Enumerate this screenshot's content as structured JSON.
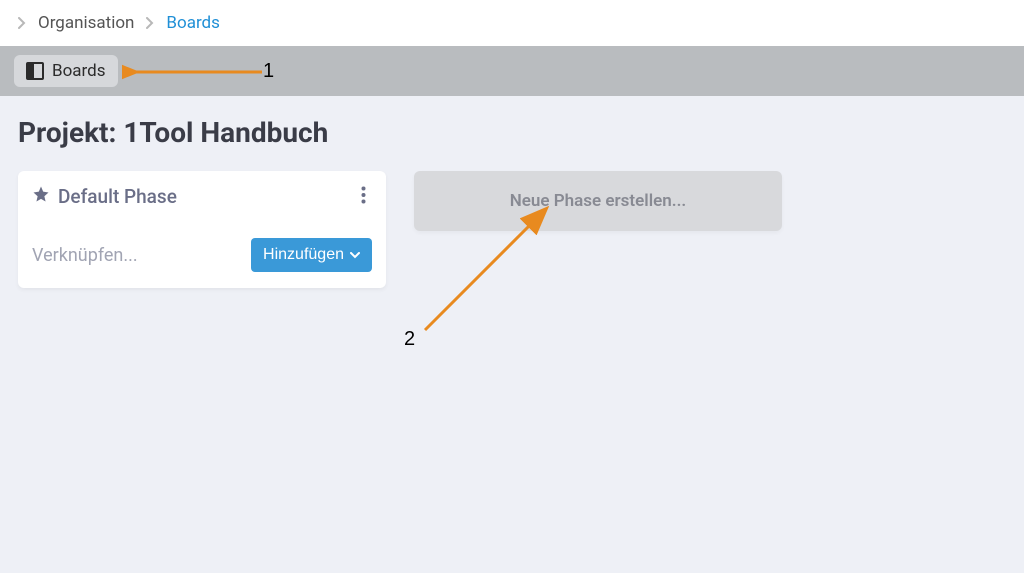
{
  "breadcrumb": {
    "item1": "Organisation",
    "item2": "Boards"
  },
  "toolbar": {
    "boards_tab": "Boards"
  },
  "project": {
    "title": "Projekt: 1Tool Handbuch"
  },
  "phase_card": {
    "title": "Default Phase",
    "link_text": "Verknüpfen...",
    "add_label": "Hinzufügen"
  },
  "new_phase": {
    "label": "Neue Phase erstellen..."
  },
  "annotations": {
    "one": "1",
    "two": "2"
  }
}
